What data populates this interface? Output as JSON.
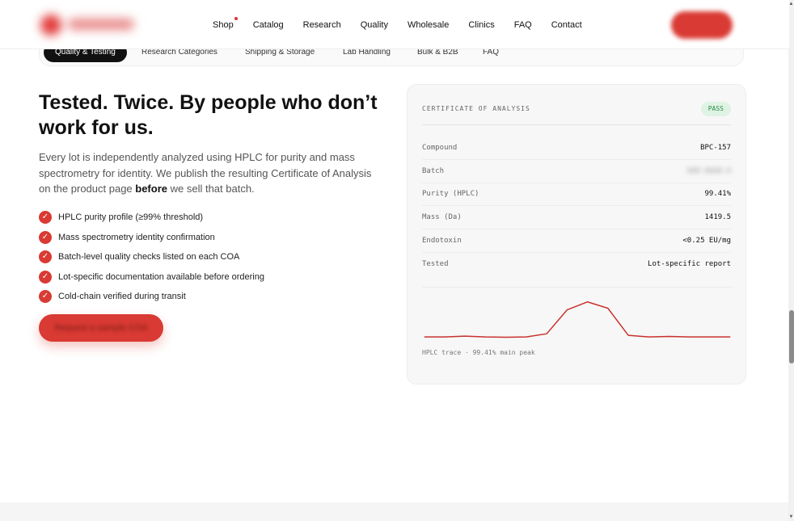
{
  "nav": {
    "items": [
      "Shop",
      "Catalog",
      "Research",
      "Quality",
      "Wholesale",
      "Clinics",
      "FAQ",
      "Contact"
    ]
  },
  "tabs": [
    "Quality & Testing",
    "Research Categories",
    "Shipping & Storage",
    "Lab Handling",
    "Bulk & B2B",
    "FAQ"
  ],
  "hero": {
    "heading": "Tested. Twice. By people who don’t work for us.",
    "lead_before": "Every lot is independently analyzed using HPLC for purity and mass spectrometry for identity. We publish the resulting Certificate of Analysis on the product page ",
    "lead_bold": "before",
    "lead_after": " we sell that batch.",
    "checks": [
      "HPLC purity profile (≥99% threshold)",
      "Mass spectrometry identity confirmation",
      "Batch-level quality checks listed on each COA",
      "Lot-specific documentation available before ordering",
      "Cold-chain verified during transit"
    ],
    "cta_label": "Request a sample COA"
  },
  "coa": {
    "title": "CERTIFICATE OF ANALYSIS",
    "status": "PASS",
    "rows": [
      {
        "k": "Compound",
        "v": "BPC-157"
      },
      {
        "k": "Batch",
        "v": "XXX-XXXX-X"
      },
      {
        "k": "Purity (HPLC)",
        "v": "99.41%"
      },
      {
        "k": "Mass (Da)",
        "v": "1419.5"
      },
      {
        "k": "Endotoxin",
        "v": "<0.25 EU/mg"
      },
      {
        "k": "Tested",
        "v": "Lot-specific report"
      }
    ],
    "caption": "HPLC trace · 99.41% main peak"
  },
  "chart_data": {
    "type": "line",
    "x": [
      0,
      1,
      2,
      3,
      4,
      5,
      6,
      7,
      8,
      9,
      10,
      11,
      12,
      13,
      14,
      15
    ],
    "values": [
      2,
      2,
      2.5,
      2,
      1.8,
      2,
      4,
      19,
      24,
      20,
      3,
      2,
      2.3,
      2,
      2,
      2
    ],
    "ylim": [
      0,
      30
    ],
    "color": "#c8312c"
  },
  "colors": {
    "accent": "#d93a33",
    "pass_bg": "#dff3e4",
    "pass_fg": "#2b8a4a"
  }
}
